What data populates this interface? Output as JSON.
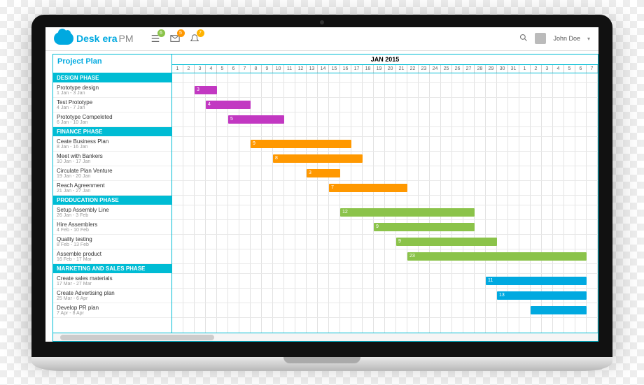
{
  "app": {
    "brand1": "Desk",
    "brand2": "era",
    "suffix": "PM"
  },
  "topbar": {
    "badges": {
      "list": "6",
      "mail": "5",
      "bell": "7"
    },
    "user": "John Doe"
  },
  "title": "Project Plan",
  "timeline": {
    "month": "JAN 2015",
    "days": [
      1,
      2,
      3,
      4,
      5,
      6,
      7,
      8,
      9,
      10,
      11,
      12,
      13,
      14,
      15,
      16,
      17,
      18,
      19,
      20,
      21,
      22,
      23,
      24,
      25,
      26,
      27,
      28,
      29,
      30,
      31,
      1,
      2,
      3,
      4,
      5,
      6,
      7
    ]
  },
  "phases": [
    {
      "name": "DESIGN PHASE",
      "tasks": [
        {
          "name": "Prototype design",
          "dates": "1 Jan - 3 Jan"
        },
        {
          "name": "Test Prototype",
          "dates": "4 Jan - 7 Jan"
        },
        {
          "name": "Prototype Compeleted",
          "dates": "6 Jan - 10 Jan"
        }
      ]
    },
    {
      "name": "FINANCE PHASE",
      "tasks": [
        {
          "name": "Ceate Business Plan",
          "dates": "8 Jan - 16 Jan"
        },
        {
          "name": "Meet with Bankers",
          "dates": "10 Jan - 17 Jan"
        },
        {
          "name": "Circulate Plan Venture",
          "dates": "19 Jan - 20 Jan"
        },
        {
          "name": "Reach Agreenment",
          "dates": "21 Jan - 27 Jan"
        }
      ]
    },
    {
      "name": "PRODUCATION PHASE",
      "tasks": [
        {
          "name": "Setup Assembly Line",
          "dates": "26 Jan - 3 Feb"
        },
        {
          "name": "Hire Assemblers",
          "dates": "4 Feb - 10 Feb"
        },
        {
          "name": "Quality testing",
          "dates": "8 Feb - 13 Feb"
        },
        {
          "name": "Assemble product",
          "dates": "16 Feb - 17 Mar"
        }
      ]
    },
    {
      "name": "MARKETING AND SALES PHASE",
      "tasks": [
        {
          "name": "Create sales materials",
          "dates": "17 Mar - 27 Mar"
        },
        {
          "name": "Create Advertising plan",
          "dates": "25 Mar - 6 Apr"
        },
        {
          "name": "Develop PR plan",
          "dates": "7 Apr - 8 Apr"
        }
      ]
    }
  ],
  "chart_data": {
    "type": "gantt",
    "title": "Project Plan",
    "x_unit": "day",
    "x_start": "2015-01-01",
    "series": [
      {
        "phase": "Design",
        "task": "Prototype design",
        "start": 3,
        "end": 5,
        "label": "3",
        "color": "#c238c2"
      },
      {
        "phase": "Design",
        "task": "Test Prototype",
        "start": 4,
        "end": 8,
        "label": "4",
        "color": "#c238c2"
      },
      {
        "phase": "Design",
        "task": "Prototype Compeleted",
        "start": 6,
        "end": 11,
        "label": "5",
        "color": "#c238c2"
      },
      {
        "phase": "Finance",
        "task": "Ceate Business Plan",
        "start": 8,
        "end": 17,
        "label": "9",
        "color": "#ff9800"
      },
      {
        "phase": "Finance",
        "task": "Meet with Bankers",
        "start": 10,
        "end": 18,
        "label": "8",
        "color": "#ff9800"
      },
      {
        "phase": "Finance",
        "task": "Circulate Plan Venture",
        "start": 13,
        "end": 16,
        "label": "3",
        "color": "#ff9800"
      },
      {
        "phase": "Finance",
        "task": "Reach Agreenment",
        "start": 15,
        "end": 22,
        "label": "7",
        "color": "#ff9800"
      },
      {
        "phase": "Production",
        "task": "Setup Assembly Line",
        "start": 16,
        "end": 28,
        "label": "12",
        "color": "#8bc34a"
      },
      {
        "phase": "Production",
        "task": "Hire Assemblers",
        "start": 19,
        "end": 28,
        "label": "9",
        "color": "#8bc34a"
      },
      {
        "phase": "Production",
        "task": "Quality testing",
        "start": 21,
        "end": 30,
        "label": "9",
        "color": "#8bc34a"
      },
      {
        "phase": "Production",
        "task": "Assemble product",
        "start": 22,
        "end": 38,
        "label": "23",
        "color": "#8bc34a"
      },
      {
        "phase": "Marketing",
        "task": "Create sales materials",
        "start": 29,
        "end": 38,
        "label": "11",
        "color": "#00a9e0"
      },
      {
        "phase": "Marketing",
        "task": "Create Advertising plan",
        "start": 30,
        "end": 38,
        "label": "13",
        "color": "#00a9e0"
      },
      {
        "phase": "Marketing",
        "task": "Develop PR plan",
        "start": 33,
        "end": 38,
        "label": "",
        "color": "#00a9e0"
      }
    ]
  }
}
